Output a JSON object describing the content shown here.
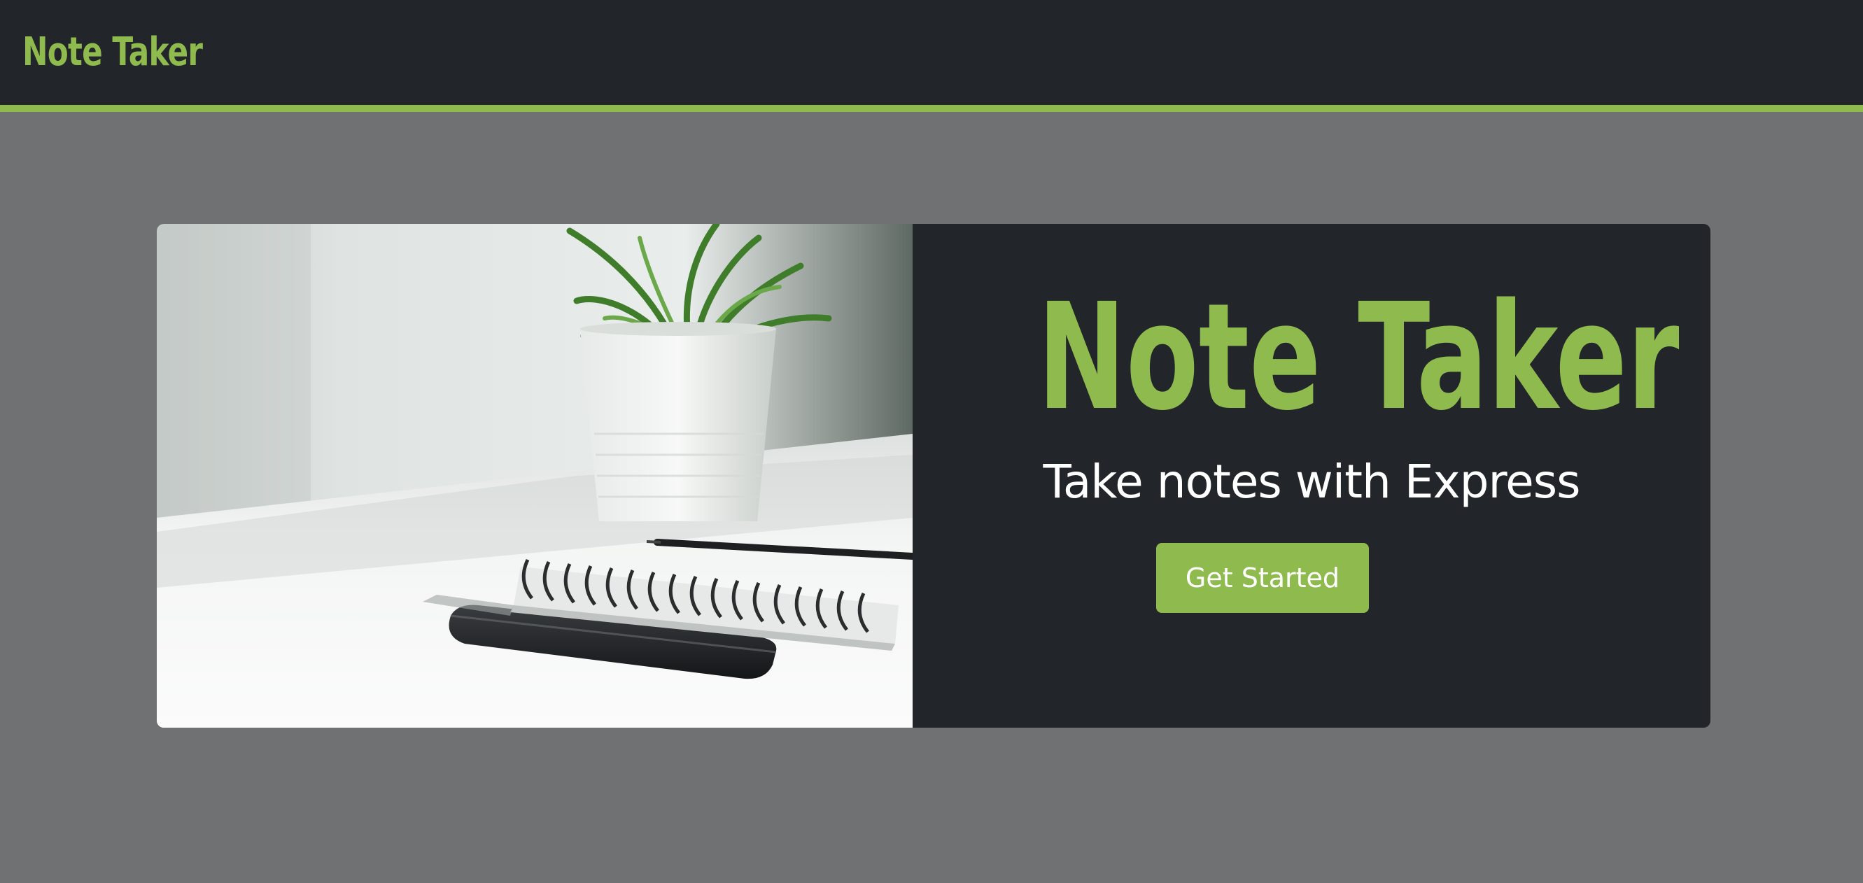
{
  "navbar": {
    "brand": "Note Taker"
  },
  "hero": {
    "title": "Note Taker",
    "subtitle": "Take notes with Express",
    "cta_label": "Get Started"
  },
  "colors": {
    "accent": "#8fbb4e",
    "navbar_bg": "#222529",
    "page_bg": "#707173",
    "hero_panel_bg": "#222529",
    "text_light": "#ffffff"
  },
  "icons": {
    "hero_image": "desk-plant-notebook-photo"
  }
}
